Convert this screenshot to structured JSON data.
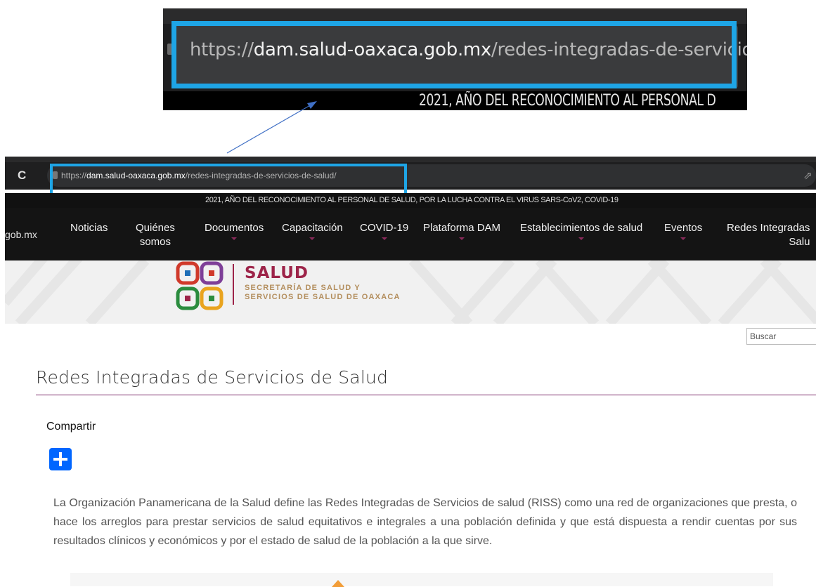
{
  "zoom_inset": {
    "url_scheme": "https://",
    "url_domain": "dam.salud-oaxaca.gob.mx",
    "url_path": "/redes-integradas-de-servicios-de-salud/",
    "announcement": "2021, AÑO DEL RECONOCIMIENTO AL PERSONAL D"
  },
  "browser": {
    "url_scheme": "https://",
    "url_domain": "dam.salud-oaxaca.gob.mx",
    "url_path": "/redes-integradas-de-servicios-de-salud/"
  },
  "announcement": "2021, AÑO DEL RECONOCIMIENTO AL PERSONAL DE SALUD, POR LA LUCHA CONTRA EL VIRUS SARS-CoV2, COVID-19",
  "nav": {
    "domain_fragment": "gob.mx",
    "items": [
      {
        "line1": "Noticias",
        "line2": ""
      },
      {
        "line1": "Quiénes",
        "line2": "somos"
      },
      {
        "line1": "Documentos",
        "line2": ""
      },
      {
        "line1": "Capacitación",
        "line2": ""
      },
      {
        "line1": "COVID-19",
        "line2": ""
      },
      {
        "line1": "Plataforma DAM",
        "line2": ""
      },
      {
        "line1": "Establecimientos de salud",
        "line2": ""
      },
      {
        "line1": "Eventos",
        "line2": ""
      },
      {
        "line1": "Redes Integradas",
        "line2": "Salu"
      }
    ]
  },
  "logo": {
    "title": "SALUD",
    "subtitle_line1": "SECRETARÍA DE SALUD Y",
    "subtitle_line2": "SERVICIOS DE SALUD DE OAXACA"
  },
  "search": {
    "placeholder": "Buscar"
  },
  "page": {
    "title": "Redes Integradas de Servicios de Salud",
    "share_label": "Compartir",
    "paragraph": "La Organización Panamericana de la Salud define las Redes Integradas de Servicios de salud (RISS) como una red de organizaciones que presta, o hace los arreglos para prestar servicios de salud equitativos e integrales a una población definida y que está dispuesta a rendir cuentas por sus resultados clínicos y económicos y por el estado de salud de la población a la que sirve."
  },
  "colors": {
    "highlight": "#1ea5e6",
    "brand": "#9d2449",
    "brand_gold": "#b38e5d",
    "share_button": "#0166ff"
  }
}
